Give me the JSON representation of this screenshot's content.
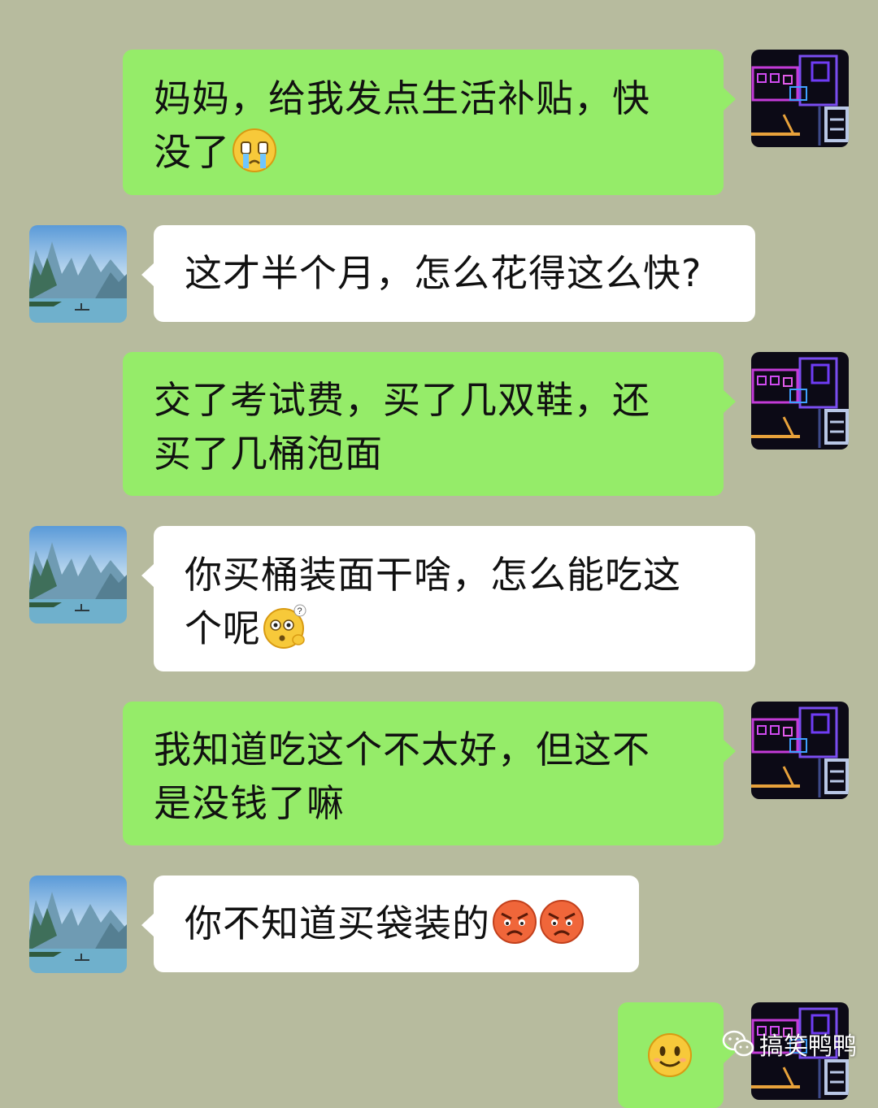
{
  "messages": [
    {
      "sender": "me",
      "text": "妈妈，给我发点生活补贴，快没了",
      "emoji": "crying-face"
    },
    {
      "sender": "mom",
      "text": "这才半个月，怎么花得这么快?"
    },
    {
      "sender": "me",
      "text": "交了考试费，买了几双鞋，还买了几桶泡面"
    },
    {
      "sender": "mom",
      "text": "你买桶装面干啥，怎么能吃这个呢",
      "emoji": "confused-face"
    },
    {
      "sender": "me",
      "text": "我知道吃这个不太好，但这不是没钱了嘛"
    },
    {
      "sender": "mom",
      "text": "你不知道买袋装的",
      "emoji": "angry-face"
    },
    {
      "sender": "me",
      "text": "",
      "emoji": "smiling-face"
    }
  ],
  "msg1": {
    "line1": "妈妈，给我发点生活补贴，快",
    "line2": "没了"
  },
  "msg3": {
    "line1": "交了考试费，买了几双鞋，还",
    "line2": "买了几桶泡面"
  },
  "msg4": {
    "line1": "你买桶装面干啥，怎么能吃这",
    "line2": "个呢"
  },
  "msg5": {
    "line1": "我知道吃这个不太好，但这不",
    "line2": "是没钱了嘛"
  },
  "watermark": {
    "text": "搞笑鸭鸭",
    "icon": "wechat-icon"
  },
  "colors": {
    "background": "#b7bb9e",
    "my_bubble": "#95ec69",
    "their_bubble": "#ffffff"
  }
}
